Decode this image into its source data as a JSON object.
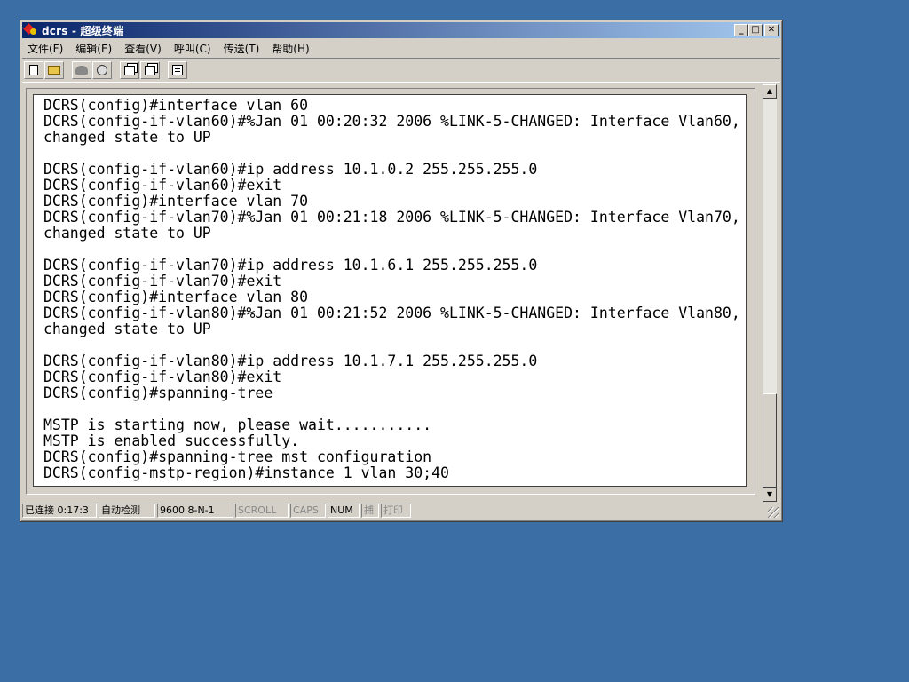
{
  "window": {
    "title": "dcrs - 超级终端",
    "buttons": {
      "minimize": "_",
      "maximize": "□",
      "close": "✕"
    }
  },
  "menu": [
    {
      "label": "文件(F)"
    },
    {
      "label": "编辑(E)"
    },
    {
      "label": "查看(V)"
    },
    {
      "label": "呼叫(C)"
    },
    {
      "label": "传送(T)"
    },
    {
      "label": "帮助(H)"
    }
  ],
  "toolbar": {
    "icons": [
      "new-icon",
      "open-icon",
      "call-icon",
      "hangup-icon",
      "send-icon",
      "receive-icon",
      "properties-icon"
    ]
  },
  "terminal": {
    "lines": [
      "DCRS(config)#interface vlan 60",
      "DCRS(config-if-vlan60)#%Jan 01 00:20:32 2006 %LINK-5-CHANGED: Interface Vlan60,",
      "changed state to UP",
      "",
      "DCRS(config-if-vlan60)#ip address 10.1.0.2 255.255.255.0",
      "DCRS(config-if-vlan60)#exit",
      "DCRS(config)#interface vlan 70",
      "DCRS(config-if-vlan70)#%Jan 01 00:21:18 2006 %LINK-5-CHANGED: Interface Vlan70,",
      "changed state to UP",
      "",
      "DCRS(config-if-vlan70)#ip address 10.1.6.1 255.255.255.0",
      "DCRS(config-if-vlan70)#exit",
      "DCRS(config)#interface vlan 80",
      "DCRS(config-if-vlan80)#%Jan 01 00:21:52 2006 %LINK-5-CHANGED: Interface Vlan80,",
      "changed state to UP",
      "",
      "DCRS(config-if-vlan80)#ip address 10.1.7.1 255.255.255.0",
      "DCRS(config-if-vlan80)#exit",
      "DCRS(config)#spanning-tree",
      "",
      "MSTP is starting now, please wait...........",
      "MSTP is enabled successfully.",
      "DCRS(config)#spanning-tree mst configuration",
      "DCRS(config-mstp-region)#instance 1 vlan 30;40"
    ]
  },
  "status": {
    "connected": "已连接 0:17:3",
    "detect": "自动检测",
    "port": "9600 8-N-1",
    "scroll": "SCROLL",
    "caps": "CAPS",
    "num": "NUM",
    "capture": "捕",
    "print": "打印"
  }
}
